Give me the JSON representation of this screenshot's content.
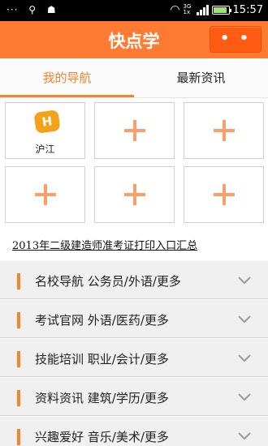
{
  "status": {
    "left_icons": [
      "more-dots-icon",
      "usb-icon",
      "android-icon"
    ],
    "network": "3G",
    "network_sub": "1x",
    "time": "15:57",
    "battery_level_percent": 90
  },
  "header": {
    "title": "快点学",
    "menu_label": "• • •"
  },
  "tabs": [
    {
      "label": "我的导航",
      "active": true
    },
    {
      "label": "最新资讯",
      "active": false
    }
  ],
  "nav_grid": {
    "items": [
      {
        "label": "沪江",
        "icon": "hujiang-logo-icon",
        "logo_text": "H"
      },
      {
        "label": "",
        "icon": "plus-icon"
      },
      {
        "label": "",
        "icon": "plus-icon"
      },
      {
        "label": "",
        "icon": "plus-icon"
      },
      {
        "label": "",
        "icon": "plus-icon"
      },
      {
        "label": "",
        "icon": "plus-icon"
      }
    ]
  },
  "banner": {
    "text": "2013年二级建造师准考证打印入口汇总"
  },
  "categories": [
    {
      "label": "名校导航  公务员/外语/更多"
    },
    {
      "label": "考试官网  外语/医药/更多"
    },
    {
      "label": "技能培训  职业/会计/更多"
    },
    {
      "label": "资料资讯  建筑/学历/更多"
    },
    {
      "label": "兴趣爱好  音乐/美术/更多"
    }
  ],
  "colors": {
    "accent": "#ff7a33",
    "plus": "#f7a06a",
    "tab_active": "#f7832f"
  }
}
